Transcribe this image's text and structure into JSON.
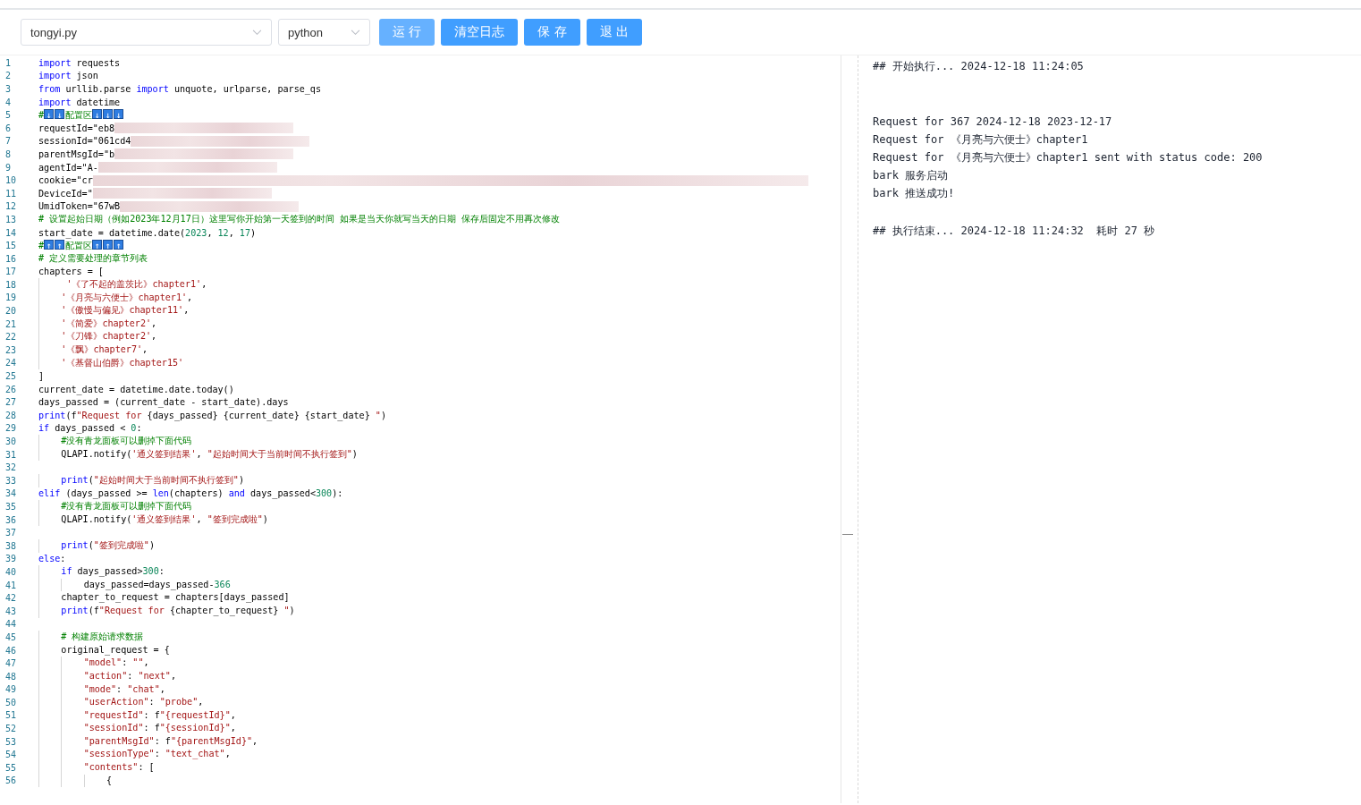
{
  "toolbar": {
    "file_select": {
      "value": "tongyi.py"
    },
    "language_select": {
      "value": "python"
    },
    "buttons": [
      {
        "label": "运 行",
        "disabled": true
      },
      {
        "label": "清空日志",
        "disabled": false
      },
      {
        "label": "保 存",
        "disabled": false
      },
      {
        "label": "退 出",
        "disabled": false
      }
    ]
  },
  "editor": {
    "lines": [
      {
        "n": "1",
        "tokens": [
          {
            "kind": "keyword",
            "text": "import"
          },
          {
            "kind": "plain",
            "text": " requests"
          }
        ]
      },
      {
        "n": "2",
        "tokens": [
          {
            "kind": "keyword",
            "text": "import"
          },
          {
            "kind": "plain",
            "text": " json"
          }
        ]
      },
      {
        "n": "3",
        "tokens": [
          {
            "kind": "keyword",
            "text": "from"
          },
          {
            "kind": "plain",
            "text": " urllib.parse "
          },
          {
            "kind": "keyword",
            "text": "import"
          },
          {
            "kind": "plain",
            "text": " unquote, urlparse, parse_qs"
          }
        ]
      },
      {
        "n": "4",
        "tokens": [
          {
            "kind": "keyword",
            "text": "import"
          },
          {
            "kind": "plain",
            "text": " datetime"
          }
        ]
      },
      {
        "n": "5",
        "tokens": [
          {
            "kind": "comment",
            "text": "#"
          },
          {
            "kind": "emoji",
            "text": "↓"
          },
          {
            "kind": "emoji",
            "text": "↓"
          },
          {
            "kind": "comment",
            "text": "配置区"
          },
          {
            "kind": "emoji",
            "text": "↓"
          },
          {
            "kind": "emoji",
            "text": "↓"
          },
          {
            "kind": "emoji",
            "text": "↓"
          }
        ]
      },
      {
        "n": "6",
        "tokens": [
          {
            "kind": "plain",
            "text": "requestId=\"eb8"
          }
        ],
        "kind": "redacted"
      },
      {
        "n": "7",
        "tokens": [
          {
            "kind": "plain",
            "text": "sessionId=\"061cd4"
          }
        ],
        "kind": "redacted"
      },
      {
        "n": "8",
        "tokens": [
          {
            "kind": "plain",
            "text": "parentMsgId=\"b"
          }
        ],
        "kind": "redacted"
      },
      {
        "n": "9",
        "tokens": [
          {
            "kind": "plain",
            "text": "agentId=\"A-"
          }
        ],
        "kind": "redacted"
      },
      {
        "n": "10",
        "tokens": [
          {
            "kind": "plain",
            "text": "cookie=\"cr"
          }
        ],
        "kind": "redacted_wide"
      },
      {
        "n": "11",
        "tokens": [
          {
            "kind": "plain",
            "text": "DeviceId=\""
          }
        ],
        "kind": "redacted"
      },
      {
        "n": "12",
        "tokens": [
          {
            "kind": "plain",
            "text": "UmidToken=\"67wB"
          }
        ],
        "kind": "redacted"
      },
      {
        "n": "13",
        "tokens": [
          {
            "kind": "comment",
            "text": "# 设置起始日期（例如2023年12月17日）这里写你开始第一天签到的时间 如果是当天你就写当天的日期 保存后固定不用再次修改"
          }
        ]
      },
      {
        "n": "14",
        "tokens": [
          {
            "kind": "plain",
            "text": "start_date = datetime.date("
          },
          {
            "kind": "number",
            "text": "2023"
          },
          {
            "kind": "plain",
            "text": ", "
          },
          {
            "kind": "number",
            "text": "12"
          },
          {
            "kind": "plain",
            "text": ", "
          },
          {
            "kind": "number",
            "text": "17"
          },
          {
            "kind": "plain",
            "text": ")"
          }
        ]
      },
      {
        "n": "15",
        "tokens": [
          {
            "kind": "comment",
            "text": "#"
          },
          {
            "kind": "emoji",
            "text": "↑"
          },
          {
            "kind": "emoji",
            "text": "↑"
          },
          {
            "kind": "comment",
            "text": "配置区"
          },
          {
            "kind": "emoji",
            "text": "↑"
          },
          {
            "kind": "emoji",
            "text": "↑"
          },
          {
            "kind": "emoji",
            "text": "↑"
          }
        ]
      },
      {
        "n": "16",
        "tokens": [
          {
            "kind": "comment",
            "text": "# 定义需要处理的章节列表"
          }
        ]
      },
      {
        "n": "17",
        "tokens": [
          {
            "kind": "plain",
            "text": "chapters = ["
          }
        ]
      },
      {
        "n": "18",
        "tokens": [
          {
            "kind": "string",
            "text": "     '《了不起的盖茨比》chapter1'"
          },
          {
            "kind": "plain",
            "text": ","
          }
        ]
      },
      {
        "n": "19",
        "tokens": [
          {
            "kind": "string",
            "text": "    '《月亮与六便士》chapter1'"
          },
          {
            "kind": "plain",
            "text": ","
          }
        ]
      },
      {
        "n": "20",
        "tokens": [
          {
            "kind": "string",
            "text": "    '《傲慢与偏见》chapter11'"
          },
          {
            "kind": "plain",
            "text": ","
          }
        ]
      },
      {
        "n": "21",
        "tokens": [
          {
            "kind": "string",
            "text": "    '《简爱》chapter2'"
          },
          {
            "kind": "plain",
            "text": ","
          }
        ]
      },
      {
        "n": "22",
        "tokens": [
          {
            "kind": "string",
            "text": "    '《刀锋》chapter2'"
          },
          {
            "kind": "plain",
            "text": ","
          }
        ]
      },
      {
        "n": "23",
        "tokens": [
          {
            "kind": "string",
            "text": "    '《飘》chapter7'"
          },
          {
            "kind": "plain",
            "text": ","
          }
        ]
      },
      {
        "n": "24",
        "tokens": [
          {
            "kind": "string",
            "text": "    '《基督山伯爵》chapter15'"
          }
        ]
      },
      {
        "n": "25",
        "tokens": [
          {
            "kind": "plain",
            "text": "]"
          }
        ]
      },
      {
        "n": "26",
        "tokens": [
          {
            "kind": "plain",
            "text": "current_date = datetime.date.today()"
          }
        ]
      },
      {
        "n": "27",
        "tokens": [
          {
            "kind": "plain",
            "text": "days_passed = (current_date - start_date).days"
          }
        ]
      },
      {
        "n": "28",
        "tokens": [
          {
            "kind": "keyword",
            "text": "print"
          },
          {
            "kind": "plain",
            "text": "(f"
          },
          {
            "kind": "string",
            "text": "\"Request for "
          },
          {
            "kind": "plain",
            "text": "{days_passed} {current_date} {start_date}"
          },
          {
            "kind": "string",
            "text": " \""
          },
          {
            "kind": "plain",
            "text": ")"
          }
        ]
      },
      {
        "n": "29",
        "tokens": [
          {
            "kind": "keyword",
            "text": "if"
          },
          {
            "kind": "plain",
            "text": " days_passed < "
          },
          {
            "kind": "number",
            "text": "0"
          },
          {
            "kind": "plain",
            "text": ":"
          }
        ]
      },
      {
        "n": "30",
        "tokens": [
          {
            "kind": "comment",
            "text": "    #没有青龙面板可以删掉下面代码"
          }
        ]
      },
      {
        "n": "31",
        "tokens": [
          {
            "kind": "plain",
            "text": "    QLAPI.notify("
          },
          {
            "kind": "string",
            "text": "'通义签到结果'"
          },
          {
            "kind": "plain",
            "text": ", "
          },
          {
            "kind": "string",
            "text": "\"起始时间大于当前时间不执行签到\""
          },
          {
            "kind": "plain",
            "text": ")"
          }
        ]
      },
      {
        "n": "32"
      },
      {
        "n": "33",
        "tokens": [
          {
            "kind": "keyword",
            "text": "    print"
          },
          {
            "kind": "plain",
            "text": "("
          },
          {
            "kind": "string",
            "text": "\"起始时间大于当前时间不执行签到\""
          },
          {
            "kind": "plain",
            "text": ")"
          }
        ]
      },
      {
        "n": "34",
        "tokens": [
          {
            "kind": "keyword",
            "text": "elif"
          },
          {
            "kind": "plain",
            "text": " (days_passed >= "
          },
          {
            "kind": "keyword",
            "text": "len"
          },
          {
            "kind": "plain",
            "text": "(chapters) "
          },
          {
            "kind": "keyword",
            "text": "and"
          },
          {
            "kind": "plain",
            "text": " days_passed<"
          },
          {
            "kind": "number",
            "text": "300"
          },
          {
            "kind": "plain",
            "text": "):"
          }
        ]
      },
      {
        "n": "35",
        "tokens": [
          {
            "kind": "comment",
            "text": "    #没有青龙面板可以删掉下面代码"
          }
        ]
      },
      {
        "n": "36",
        "tokens": [
          {
            "kind": "plain",
            "text": "    QLAPI.notify("
          },
          {
            "kind": "string",
            "text": "'通义签到结果'"
          },
          {
            "kind": "plain",
            "text": ", "
          },
          {
            "kind": "string",
            "text": "\"签到完成啦\""
          },
          {
            "kind": "plain",
            "text": ")"
          }
        ]
      },
      {
        "n": "37"
      },
      {
        "n": "38",
        "tokens": [
          {
            "kind": "keyword",
            "text": "    print"
          },
          {
            "kind": "plain",
            "text": "("
          },
          {
            "kind": "string",
            "text": "\"签到完成啦\""
          },
          {
            "kind": "plain",
            "text": ")"
          }
        ]
      },
      {
        "n": "39",
        "tokens": [
          {
            "kind": "keyword",
            "text": "else"
          },
          {
            "kind": "plain",
            "text": ":"
          }
        ]
      },
      {
        "n": "40",
        "tokens": [
          {
            "kind": "keyword",
            "text": "    if"
          },
          {
            "kind": "plain",
            "text": " days_passed>"
          },
          {
            "kind": "number",
            "text": "300"
          },
          {
            "kind": "plain",
            "text": ":"
          }
        ]
      },
      {
        "n": "41",
        "tokens": [
          {
            "kind": "plain",
            "text": "        days_passed=days_passed-"
          },
          {
            "kind": "number",
            "text": "366"
          }
        ]
      },
      {
        "n": "42",
        "tokens": [
          {
            "kind": "plain",
            "text": "    chapter_to_request = chapters[days_passed]"
          }
        ]
      },
      {
        "n": "43",
        "tokens": [
          {
            "kind": "keyword",
            "text": "    print"
          },
          {
            "kind": "plain",
            "text": "(f"
          },
          {
            "kind": "string",
            "text": "\"Request for "
          },
          {
            "kind": "plain",
            "text": "{chapter_to_request}"
          },
          {
            "kind": "string",
            "text": " \""
          },
          {
            "kind": "plain",
            "text": ")"
          }
        ]
      },
      {
        "n": "44"
      },
      {
        "n": "45",
        "tokens": [
          {
            "kind": "comment",
            "text": "    # 构建原始请求数据"
          }
        ]
      },
      {
        "n": "46",
        "tokens": [
          {
            "kind": "plain",
            "text": "    original_request = {"
          }
        ]
      },
      {
        "n": "47",
        "tokens": [
          {
            "kind": "string",
            "text": "        \"model\""
          },
          {
            "kind": "plain",
            "text": ": "
          },
          {
            "kind": "string",
            "text": "\"\""
          },
          {
            "kind": "plain",
            "text": ","
          }
        ]
      },
      {
        "n": "48",
        "tokens": [
          {
            "kind": "string",
            "text": "        \"action\""
          },
          {
            "kind": "plain",
            "text": ": "
          },
          {
            "kind": "string",
            "text": "\"next\""
          },
          {
            "kind": "plain",
            "text": ","
          }
        ]
      },
      {
        "n": "49",
        "tokens": [
          {
            "kind": "string",
            "text": "        \"mode\""
          },
          {
            "kind": "plain",
            "text": ": "
          },
          {
            "kind": "string",
            "text": "\"chat\""
          },
          {
            "kind": "plain",
            "text": ","
          }
        ]
      },
      {
        "n": "50",
        "tokens": [
          {
            "kind": "string",
            "text": "        \"userAction\""
          },
          {
            "kind": "plain",
            "text": ": "
          },
          {
            "kind": "string",
            "text": "\"probe\""
          },
          {
            "kind": "plain",
            "text": ","
          }
        ]
      },
      {
        "n": "51",
        "tokens": [
          {
            "kind": "string",
            "text": "        \"requestId\""
          },
          {
            "kind": "plain",
            "text": ": f"
          },
          {
            "kind": "string",
            "text": "\"{requestId}\""
          },
          {
            "kind": "plain",
            "text": ","
          }
        ]
      },
      {
        "n": "52",
        "tokens": [
          {
            "kind": "string",
            "text": "        \"sessionId\""
          },
          {
            "kind": "plain",
            "text": ": f"
          },
          {
            "kind": "string",
            "text": "\"{sessionId}\""
          },
          {
            "kind": "plain",
            "text": ","
          }
        ]
      },
      {
        "n": "53",
        "tokens": [
          {
            "kind": "string",
            "text": "        \"parentMsgId\""
          },
          {
            "kind": "plain",
            "text": ": f"
          },
          {
            "kind": "string",
            "text": "\"{parentMsgId}\""
          },
          {
            "kind": "plain",
            "text": ","
          }
        ]
      },
      {
        "n": "54",
        "tokens": [
          {
            "kind": "string",
            "text": "        \"sessionType\""
          },
          {
            "kind": "plain",
            "text": ": "
          },
          {
            "kind": "string",
            "text": "\"text_chat\""
          },
          {
            "kind": "plain",
            "text": ","
          }
        ]
      },
      {
        "n": "55",
        "tokens": [
          {
            "kind": "string",
            "text": "        \"contents\""
          },
          {
            "kind": "plain",
            "text": ": ["
          }
        ]
      },
      {
        "n": "56",
        "tokens": [
          {
            "kind": "plain",
            "text": "            {"
          }
        ]
      }
    ]
  },
  "log": {
    "groups": [
      {
        "lines": [
          "## 开始执行... 2024-12-18 11:24:05"
        ]
      },
      {
        "lines": [
          "Request for 367 2024-12-18 2023-12-17",
          "Request for 《月亮与六便士》chapter1",
          "Request for 《月亮与六便士》chapter1 sent with status code: 200",
          "bark 服务启动",
          "bark 推送成功!"
        ]
      },
      {
        "lines": [
          "## 执行结束... 2024-12-18 11:24:32  耗时 27 秒"
        ]
      }
    ]
  }
}
